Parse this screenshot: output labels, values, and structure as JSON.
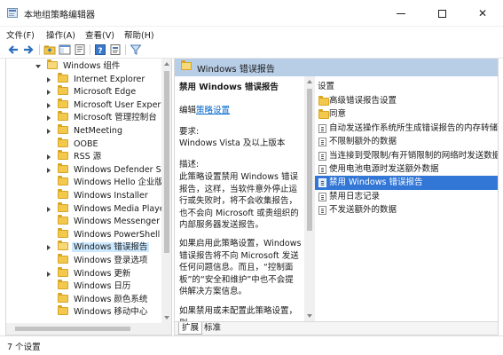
{
  "window": {
    "title": "本地组策略编辑器",
    "minimize_glyph": "",
    "maximize_glyph": "",
    "close_glyph": "✕"
  },
  "menu": [
    "文件(F)",
    "操作(A)",
    "查看(V)",
    "帮助(H)"
  ],
  "toolbar_icons": [
    "back-arrow-icon",
    "forward-arrow-icon",
    "up-folder-icon",
    "show-hide-tree-icon",
    "export-list-icon",
    "help-icon",
    "properties-icon",
    "filter-icon"
  ],
  "tree": {
    "parent": "Windows 组件",
    "items": [
      "Internet Explorer",
      "Microsoft Edge",
      "Microsoft User Experie",
      "Microsoft 管理控制台",
      "NetMeeting",
      "OOBE",
      "RSS 源",
      "Windows Defender Sm",
      "Windows Hello 企业版",
      "Windows Installer",
      "Windows Media Player",
      "Windows Messenger",
      "Windows PowerShell",
      "Windows 错误报告",
      "Windows 登录选项",
      "Windows 更新",
      "Windows 日历",
      "Windows 颜色系统",
      "Windows 移动中心"
    ],
    "selected_item": "Windows 错误报告"
  },
  "header": {
    "title": "Windows 错误报告"
  },
  "description": {
    "title": "禁用 Windows 错误报告",
    "edit_prefix": "编辑",
    "edit_link": "策略设置",
    "requirement_label": "要求:",
    "requirement_value": "Windows Vista 及以上版本",
    "description_label": "描述:",
    "description_text": "此策略设置禁用 Windows 错误报告，这样，当软件意外停止运行或失败时，将不会收集报告，也不会向 Microsoft 或贵组织的内部服务器发送报告。",
    "enabled_text": "如果启用此策略设置，Windows 错误报告将不向 Microsoft 发送任何问题信息。而且，“控制面板”的“安全和维护”中也不会提供解决方案信息。",
    "disabled_text": "如果禁用或未配置此策略设置，则"
  },
  "settings": {
    "header": "设置",
    "items": [
      {
        "label": "高级错误报告设置",
        "icon": "folder-icon"
      },
      {
        "label": "同意",
        "icon": "folder-icon"
      },
      {
        "label": "自动发送操作系统所生成错误报告的内存转储",
        "icon": "policy-icon"
      },
      {
        "label": "不限制额外的数据",
        "icon": "policy-icon"
      },
      {
        "label": "当连接到受限制/有开销限制的网络时发送数据",
        "icon": "policy-icon"
      },
      {
        "label": "使用电池电源时发送额外数据",
        "icon": "policy-icon"
      },
      {
        "label": "禁用 Windows 错误报告",
        "icon": "policy-icon"
      },
      {
        "label": "禁用日志记录",
        "icon": "policy-icon"
      },
      {
        "label": "不发送额外的数据",
        "icon": "policy-icon"
      }
    ],
    "selected_item": "禁用 Windows 错误报告"
  },
  "tabs": [
    "扩展",
    "标准"
  ],
  "status": "7 个设置",
  "colors": {
    "header_band": "#b8cde6",
    "selection": "#3377d6",
    "tree_selection": "#cce8ff",
    "link": "#0066cc",
    "folder": "#f2c94c"
  }
}
